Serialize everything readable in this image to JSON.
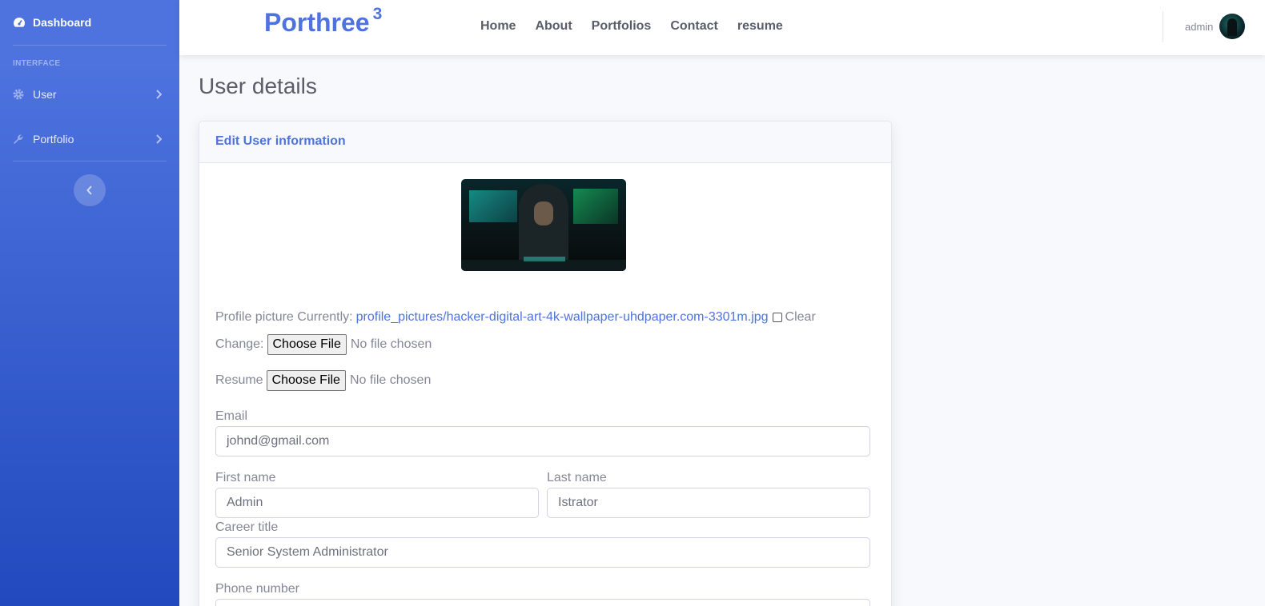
{
  "sidebar": {
    "dashboard_label": "Dashboard",
    "heading": "INTERFACE",
    "items": [
      {
        "label": "User",
        "icon": "gear-icon"
      },
      {
        "label": "Portfolio",
        "icon": "wrench-icon"
      }
    ]
  },
  "topbar": {
    "brand": "Porthree",
    "brand_sup": "3",
    "nav": [
      "Home",
      "About",
      "Portfolios",
      "Contact",
      "resume"
    ],
    "user_name": "admin"
  },
  "page": {
    "title": "User details",
    "card_title": "Edit User information"
  },
  "form": {
    "profile_label": "Profile picture Currently:",
    "profile_link": "profile_pictures/hacker-digital-art-4k-wallpaper-uhdpaper.com-3301m.jpg",
    "clear_label": "Clear",
    "change_label": "Change:",
    "choose_file": "Choose File",
    "no_file": "No file chosen",
    "resume_label": "Resume",
    "email_label": "Email",
    "email_value": "johnd@gmail.com",
    "first_name_label": "First name",
    "first_name_value": "Admin",
    "last_name_label": "Last name",
    "last_name_value": "Istrator",
    "career_label": "Career title",
    "career_value": "Senior System Administrator",
    "phone_label": "Phone number"
  },
  "colors": {
    "primary": "#4e73df",
    "sidebar_dark": "#224abe",
    "text_muted": "#858796"
  }
}
